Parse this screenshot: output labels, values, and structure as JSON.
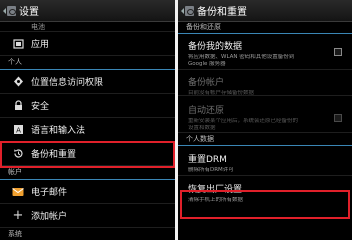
{
  "left": {
    "title": "设置",
    "partial_top_label": "电池",
    "items_apps": {
      "label": "应用"
    },
    "section_personal": "个人",
    "personal_items": [
      {
        "label": "位置信息访问权限",
        "icon": "location-icon"
      },
      {
        "label": "安全",
        "icon": "lock-icon"
      },
      {
        "label": "语言和输入法",
        "icon": "language-icon"
      },
      {
        "label": "备份和重置",
        "icon": "backup-restore-icon"
      }
    ],
    "section_accounts": "帐户",
    "account_items": [
      {
        "label": "电子邮件",
        "icon": "email-icon"
      },
      {
        "label": "添加帐户",
        "icon": "add-icon"
      }
    ],
    "partial_bottom_label": "系统"
  },
  "right": {
    "title": "备份和重置",
    "section_backup": "备份和还原",
    "backup_data": {
      "title": "备份我的数据",
      "summary_1": "将应用数据、WLAN 密码和其他设置备份到",
      "summary_2": "Google 服务器"
    },
    "backup_account": {
      "title": "备份帐户",
      "summary": "目前没有帐户存储备份数据"
    },
    "auto_restore": {
      "title": "自动还原",
      "summary_1": "重新安装某个应用后，系统会还原已经备份的",
      "summary_2": "设置和数据"
    },
    "section_personal": "个人数据",
    "reset_drm": {
      "title": "重置DRM",
      "summary": "删除所有DRM许可"
    },
    "factory_reset": {
      "title": "恢复出厂设置",
      "summary": "清除手机上的所有数据"
    }
  },
  "colors": {
    "highlight": "#e0202a",
    "accent_divider": "#3a86b5"
  }
}
